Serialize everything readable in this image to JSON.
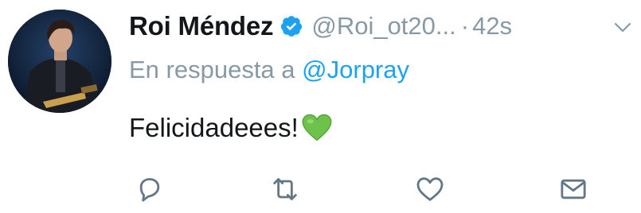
{
  "tweet": {
    "author_name": "Roi Méndez",
    "handle": "@Roi_ot20...",
    "separator": "·",
    "time": "42s",
    "reply_prefix": "En respuesta a",
    "reply_to": "@Jorpray",
    "text": "Felicidadeees!",
    "emoji": "green-heart-icon"
  },
  "icons": {
    "verified": "verified-badge-icon",
    "menu": "chevron-down-icon",
    "reply": "reply-icon",
    "retweet": "retweet-icon",
    "like": "like-icon",
    "dm": "direct-message-icon"
  },
  "colors": {
    "name": "#14171a",
    "secondary": "#8899a6",
    "accent": "#1da1f2",
    "emoji": "#6cc24a"
  }
}
